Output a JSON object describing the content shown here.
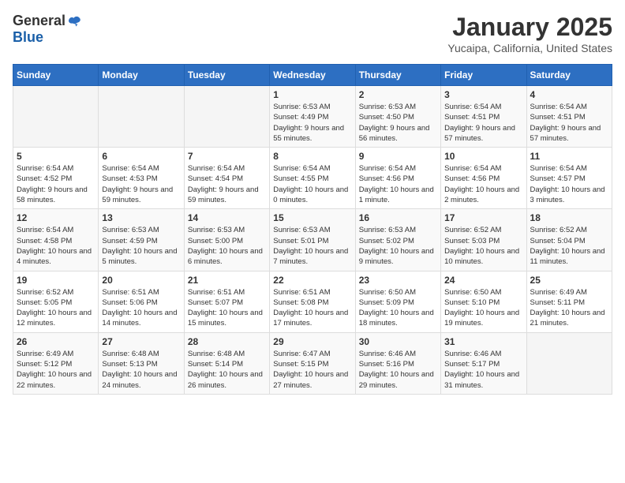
{
  "header": {
    "logo_general": "General",
    "logo_blue": "Blue",
    "month_title": "January 2025",
    "location": "Yucaipa, California, United States"
  },
  "days_of_week": [
    "Sunday",
    "Monday",
    "Tuesday",
    "Wednesday",
    "Thursday",
    "Friday",
    "Saturday"
  ],
  "weeks": [
    {
      "cells": [
        {
          "day": "",
          "info": ""
        },
        {
          "day": "",
          "info": ""
        },
        {
          "day": "",
          "info": ""
        },
        {
          "day": "1",
          "info": "Sunrise: 6:53 AM\nSunset: 4:49 PM\nDaylight: 9 hours and 55 minutes."
        },
        {
          "day": "2",
          "info": "Sunrise: 6:53 AM\nSunset: 4:50 PM\nDaylight: 9 hours and 56 minutes."
        },
        {
          "day": "3",
          "info": "Sunrise: 6:54 AM\nSunset: 4:51 PM\nDaylight: 9 hours and 57 minutes."
        },
        {
          "day": "4",
          "info": "Sunrise: 6:54 AM\nSunset: 4:51 PM\nDaylight: 9 hours and 57 minutes."
        }
      ]
    },
    {
      "cells": [
        {
          "day": "5",
          "info": "Sunrise: 6:54 AM\nSunset: 4:52 PM\nDaylight: 9 hours and 58 minutes."
        },
        {
          "day": "6",
          "info": "Sunrise: 6:54 AM\nSunset: 4:53 PM\nDaylight: 9 hours and 59 minutes."
        },
        {
          "day": "7",
          "info": "Sunrise: 6:54 AM\nSunset: 4:54 PM\nDaylight: 9 hours and 59 minutes."
        },
        {
          "day": "8",
          "info": "Sunrise: 6:54 AM\nSunset: 4:55 PM\nDaylight: 10 hours and 0 minutes."
        },
        {
          "day": "9",
          "info": "Sunrise: 6:54 AM\nSunset: 4:56 PM\nDaylight: 10 hours and 1 minute."
        },
        {
          "day": "10",
          "info": "Sunrise: 6:54 AM\nSunset: 4:56 PM\nDaylight: 10 hours and 2 minutes."
        },
        {
          "day": "11",
          "info": "Sunrise: 6:54 AM\nSunset: 4:57 PM\nDaylight: 10 hours and 3 minutes."
        }
      ]
    },
    {
      "cells": [
        {
          "day": "12",
          "info": "Sunrise: 6:54 AM\nSunset: 4:58 PM\nDaylight: 10 hours and 4 minutes."
        },
        {
          "day": "13",
          "info": "Sunrise: 6:53 AM\nSunset: 4:59 PM\nDaylight: 10 hours and 5 minutes."
        },
        {
          "day": "14",
          "info": "Sunrise: 6:53 AM\nSunset: 5:00 PM\nDaylight: 10 hours and 6 minutes."
        },
        {
          "day": "15",
          "info": "Sunrise: 6:53 AM\nSunset: 5:01 PM\nDaylight: 10 hours and 7 minutes."
        },
        {
          "day": "16",
          "info": "Sunrise: 6:53 AM\nSunset: 5:02 PM\nDaylight: 10 hours and 9 minutes."
        },
        {
          "day": "17",
          "info": "Sunrise: 6:52 AM\nSunset: 5:03 PM\nDaylight: 10 hours and 10 minutes."
        },
        {
          "day": "18",
          "info": "Sunrise: 6:52 AM\nSunset: 5:04 PM\nDaylight: 10 hours and 11 minutes."
        }
      ]
    },
    {
      "cells": [
        {
          "day": "19",
          "info": "Sunrise: 6:52 AM\nSunset: 5:05 PM\nDaylight: 10 hours and 12 minutes."
        },
        {
          "day": "20",
          "info": "Sunrise: 6:51 AM\nSunset: 5:06 PM\nDaylight: 10 hours and 14 minutes."
        },
        {
          "day": "21",
          "info": "Sunrise: 6:51 AM\nSunset: 5:07 PM\nDaylight: 10 hours and 15 minutes."
        },
        {
          "day": "22",
          "info": "Sunrise: 6:51 AM\nSunset: 5:08 PM\nDaylight: 10 hours and 17 minutes."
        },
        {
          "day": "23",
          "info": "Sunrise: 6:50 AM\nSunset: 5:09 PM\nDaylight: 10 hours and 18 minutes."
        },
        {
          "day": "24",
          "info": "Sunrise: 6:50 AM\nSunset: 5:10 PM\nDaylight: 10 hours and 19 minutes."
        },
        {
          "day": "25",
          "info": "Sunrise: 6:49 AM\nSunset: 5:11 PM\nDaylight: 10 hours and 21 minutes."
        }
      ]
    },
    {
      "cells": [
        {
          "day": "26",
          "info": "Sunrise: 6:49 AM\nSunset: 5:12 PM\nDaylight: 10 hours and 22 minutes."
        },
        {
          "day": "27",
          "info": "Sunrise: 6:48 AM\nSunset: 5:13 PM\nDaylight: 10 hours and 24 minutes."
        },
        {
          "day": "28",
          "info": "Sunrise: 6:48 AM\nSunset: 5:14 PM\nDaylight: 10 hours and 26 minutes."
        },
        {
          "day": "29",
          "info": "Sunrise: 6:47 AM\nSunset: 5:15 PM\nDaylight: 10 hours and 27 minutes."
        },
        {
          "day": "30",
          "info": "Sunrise: 6:46 AM\nSunset: 5:16 PM\nDaylight: 10 hours and 29 minutes."
        },
        {
          "day": "31",
          "info": "Sunrise: 6:46 AM\nSunset: 5:17 PM\nDaylight: 10 hours and 31 minutes."
        },
        {
          "day": "",
          "info": ""
        }
      ]
    }
  ]
}
